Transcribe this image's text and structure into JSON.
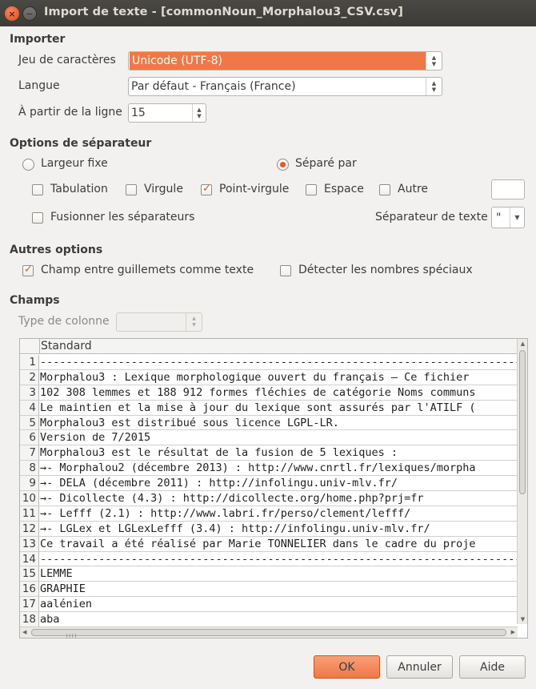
{
  "window": {
    "title": "Import de texte - [commonNoun_Morphalou3_CSV.csv]"
  },
  "importer": {
    "section": "Importer",
    "charset_label": "Jeu de caractères",
    "charset_value": "Unicode (UTF-8)",
    "language_label": "Langue",
    "language_value": "Par défaut - Français (France)",
    "from_line_label": "À partir de la ligne",
    "from_line_value": "15"
  },
  "separator": {
    "section": "Options de séparateur",
    "fixed_width": "Largeur fixe",
    "separated_by": "Séparé par",
    "tab": "Tabulation",
    "comma": "Virgule",
    "semicolon": "Point-virgule",
    "space": "Espace",
    "other": "Autre",
    "merge": "Fusionner les séparateurs",
    "text_delimiter_label": "Séparateur de texte",
    "text_delimiter_value": "\""
  },
  "other_options": {
    "section": "Autres options",
    "quoted_as_text": "Champ entre guillemets comme texte",
    "detect_special": "Détecter les nombres spéciaux"
  },
  "fields": {
    "section": "Champs",
    "column_type_label": "Type de colonne",
    "column_header": "Standard",
    "rows": [
      {
        "n": "1",
        "text": "--------------------------------------------------------------------------------------"
      },
      {
        "n": "2",
        "text": "Morphalou3 : Lexique morphologique ouvert du français – Ce fichier"
      },
      {
        "n": "3",
        "text": "102 308 lemmes et 188 912 formes fléchies de catégorie Noms communs"
      },
      {
        "n": "4",
        "text": "Le maintien et la mise à jour du lexique sont assurés par l'ATILF ("
      },
      {
        "n": "5",
        "text": "Morphalou3 est distribué sous licence LGPL-LR."
      },
      {
        "n": "6",
        "text": "Version de 7/2015"
      },
      {
        "n": "7",
        "text": "Morphalou3 est le résultat de la fusion de 5 lexiques :"
      },
      {
        "n": "8",
        "text": "→- Morphalou2 (décembre 2013) : http://www.cnrtl.fr/lexiques/morpha"
      },
      {
        "n": "9",
        "text": "→- DELA (décembre 2011) : http://infolingu.univ-mlv.fr/"
      },
      {
        "n": "10",
        "text": "→- Dicollecte (4.3) : http://dicollecte.org/home.php?prj=fr"
      },
      {
        "n": "11",
        "text": "→- Lefff (2.1) : http://www.labri.fr/perso/clement/lefff/"
      },
      {
        "n": "12",
        "text": "→- LGLex et LGLexLefff (3.4) : http://infolingu.univ-mlv.fr/"
      },
      {
        "n": "13",
        "text": "Ce travail a été réalisé par Marie TONNELIER dans le cadre du proje"
      },
      {
        "n": "14",
        "text": "--------------------------------------------------------------------------------------"
      },
      {
        "n": "15",
        "text": "LEMME"
      },
      {
        "n": "16",
        "text": "GRAPHIE"
      },
      {
        "n": "17",
        "text": "aalénien"
      },
      {
        "n": "18",
        "text": "aba"
      }
    ]
  },
  "buttons": {
    "ok": "OK",
    "cancel": "Annuler",
    "help": "Aide"
  },
  "colors": {
    "accent": "#e95420",
    "selection": "#f07746"
  }
}
